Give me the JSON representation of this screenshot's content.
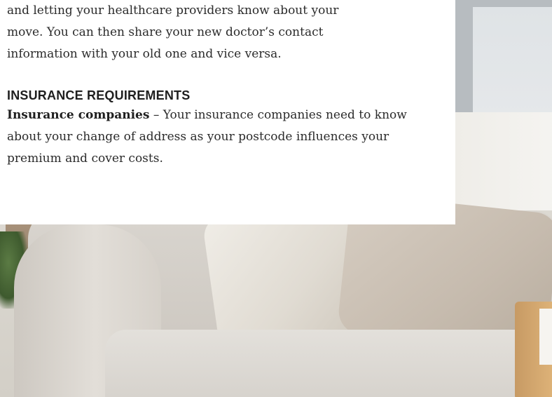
{
  "article": {
    "continued_paragraph": [
      "and letting your healthcare providers know about your",
      "move. You can then share your new doctor’s contact",
      "information with your old one and vice versa."
    ],
    "section_heading": "INSURANCE REQUIREMENTS",
    "insurance_lead": "Insurance companies",
    "insurance_body": " – Your insurance companies need to know about your change of address as your postcode influences your premium and cover costs."
  }
}
